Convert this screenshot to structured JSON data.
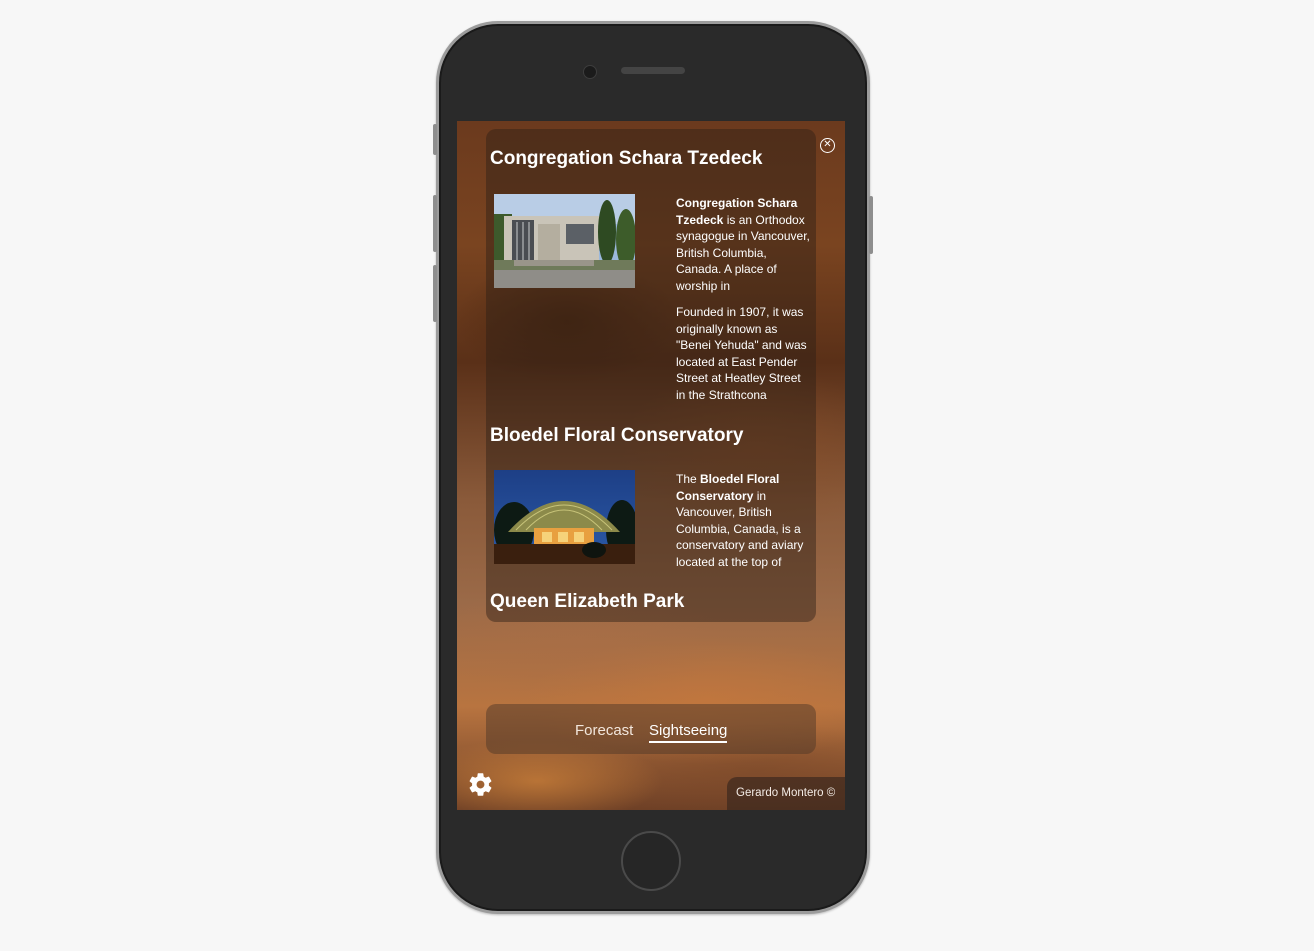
{
  "places": [
    {
      "title": "Congregation Schara Tzedeck",
      "paragraphs": [
        {
          "bold": "Congregation Schara Tzedeck",
          "rest": " is an Orthodox synagogue in Vancouver, British Columbia, Canada. A place of worship in"
        },
        {
          "bold": "",
          "rest": "Founded in 1907, it was originally known as \"Benei Yehuda\" and was located at East Pender Street at Heatley Street in the Strathcona"
        }
      ]
    },
    {
      "title": "Bloedel Floral Conservatory",
      "paragraphs": [
        {
          "pre": "The ",
          "bold": "Bloedel Floral Conservatory",
          "rest": " in Vancouver, British Columbia, Canada, is a conservatory and aviary located at the top of"
        }
      ]
    },
    {
      "title": "Queen Elizabeth Park"
    }
  ],
  "tabs": {
    "forecast": "Forecast",
    "sightseeing": "Sightseeing",
    "active": "sightseeing"
  },
  "close_icon": "close-circle-icon",
  "settings_icon": "gear-icon",
  "credit": "Gerardo Montero ©"
}
